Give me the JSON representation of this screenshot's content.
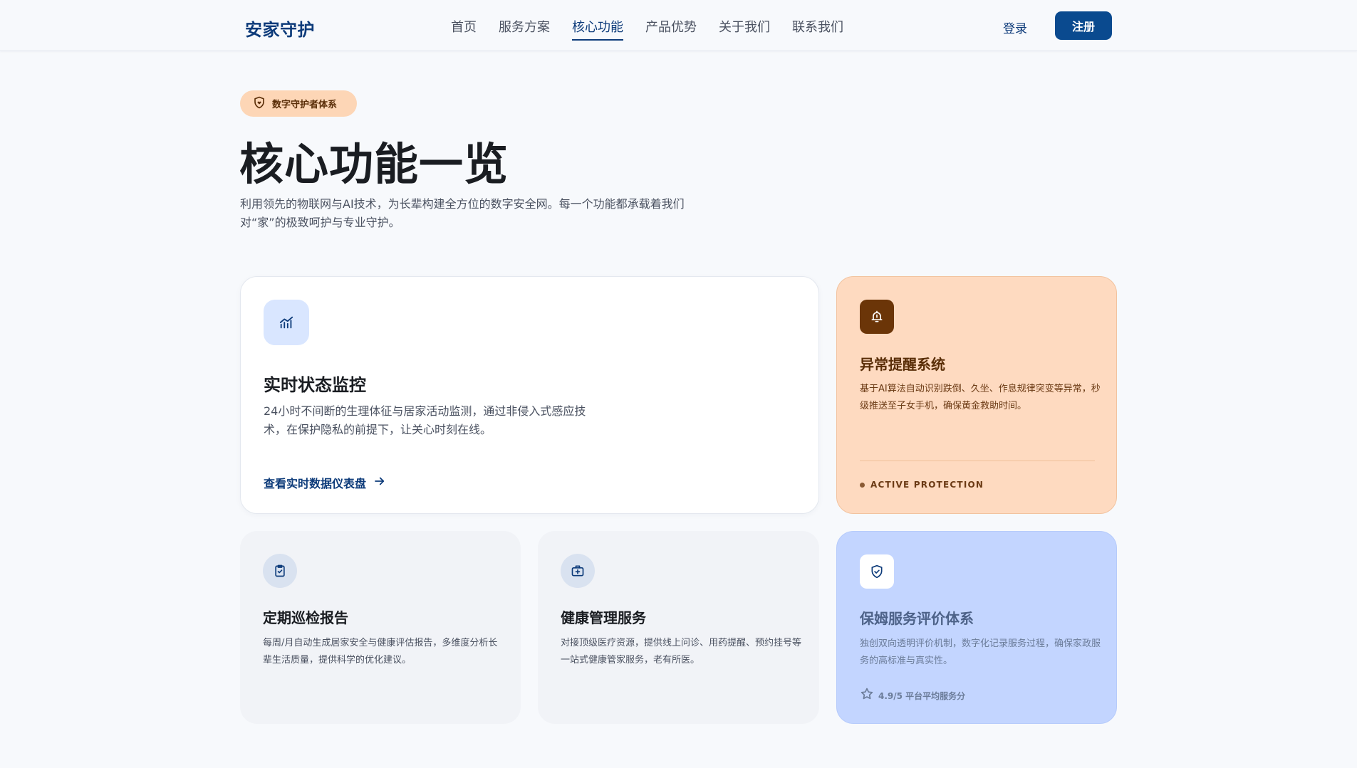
{
  "header": {
    "logo": "安家守护",
    "nav": [
      {
        "label": "首页"
      },
      {
        "label": "服务方案"
      },
      {
        "label": "核心功能"
      },
      {
        "label": "产品优势"
      },
      {
        "label": "关于我们"
      },
      {
        "label": "联系我们"
      }
    ],
    "login_label": "登录",
    "register_label": "注册"
  },
  "hero": {
    "badge": "数字守护者体系",
    "title": "核心功能一览",
    "description": "利用领先的物联网与AI技术，为长辈构建全方位的数字安全网。每一个功能都承载着我们对“家”的极致呵护与专业守护。"
  },
  "cards": {
    "monitor": {
      "title": "实时状态监控",
      "description": "24小时不间断的生理体征与居家活动监测，通过非侵入式感应技术，在保护隐私的前提下，让关心时刻在线。",
      "link": "查看实时数据仪表盘",
      "icon": "chart-icon"
    },
    "alert": {
      "title": "异常提醒系统",
      "description": "基于AI算法自动识别跌倒、久坐、作息规律突变等异常，秒级推送至子女手机，确保黄金救助时间。",
      "status": "ACTIVE PROTECTION",
      "icon": "bell-icon"
    },
    "report": {
      "title": "定期巡检报告",
      "description": "每周/月自动生成居家安全与健康评估报告，多维度分析长辈生活质量，提供科学的优化建议。",
      "icon": "clipboard-check-icon"
    },
    "health": {
      "title": "健康管理服务",
      "description": "对接顶级医疗资源，提供线上问诊、用药提醒、预约挂号等一站式健康管家服务，老有所医。",
      "icon": "medical-bag-icon"
    },
    "rating": {
      "title": "保姆服务评价体系",
      "description": "独创双向透明评价机制，数字化记录服务过程，确保家政服务的高标准与真实性。",
      "score_label": "4.9/5 平台平均服务分",
      "icon": "shield-check-icon"
    }
  },
  "colors": {
    "primary": "#0a4a8f",
    "alert_bg": "#fedac0",
    "rating_bg": "#c3d5ff",
    "muted_bg": "#f1f3f7"
  }
}
